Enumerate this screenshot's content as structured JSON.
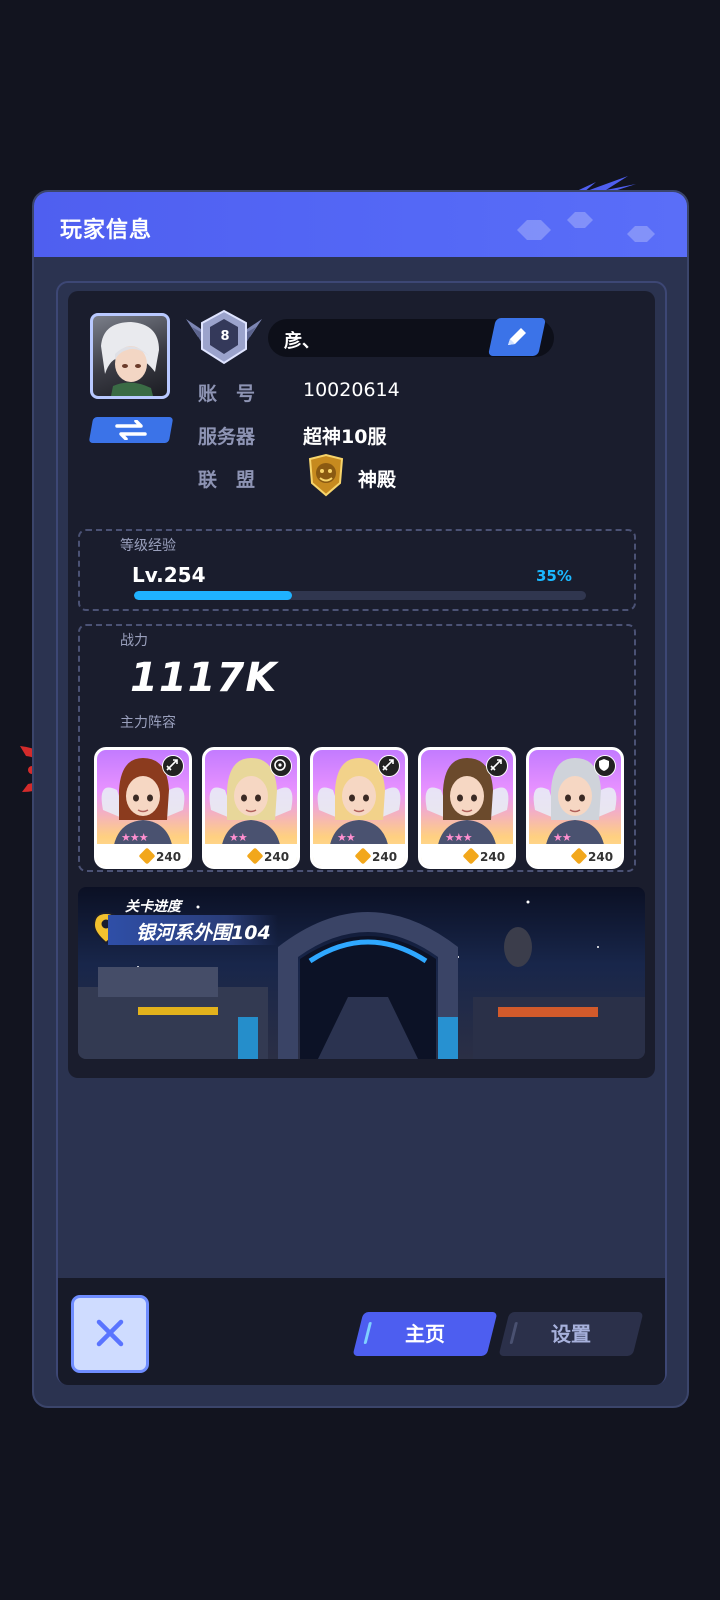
{
  "panel": {
    "title": "玩家信息"
  },
  "profile": {
    "rank_level": "8",
    "name": "彦、",
    "account_label": "账　号",
    "account_value": "10020614",
    "server_label": "服务器",
    "server_value": "超神10服",
    "alliance_label": "联　盟",
    "alliance_value": "神殿"
  },
  "experience": {
    "label": "等级经验",
    "level": "Lv.254",
    "percent_text": "35%",
    "progress": 0.35
  },
  "power": {
    "label": "战力",
    "value": "1117K",
    "lineup_label": "主力阵容"
  },
  "heroes": [
    {
      "class_icon": "archer-icon",
      "stars": "★★★",
      "level": "240"
    },
    {
      "class_icon": "mage-icon",
      "stars": "★★",
      "level": "240"
    },
    {
      "class_icon": "archer-icon",
      "stars": "★★",
      "level": "240"
    },
    {
      "class_icon": "archer-icon",
      "stars": "★★★",
      "level": "240"
    },
    {
      "class_icon": "shield-icon",
      "stars": "★★",
      "level": "240"
    }
  ],
  "stage": {
    "label": "关卡进度",
    "value": "银河系外围104"
  },
  "bottom": {
    "tab_home": "主页",
    "tab_settings": "设置"
  },
  "colors": {
    "accent": "#4d5ef0",
    "progress": "#1fb2ff",
    "panel": "#2b3350"
  }
}
